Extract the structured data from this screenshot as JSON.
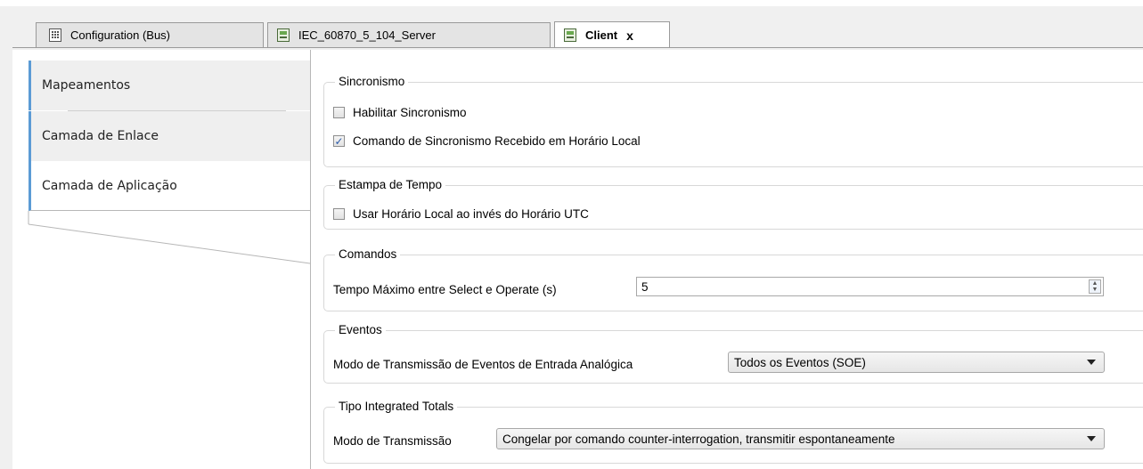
{
  "tabs": [
    {
      "label": "Configuration (Bus)",
      "icon": "bus-config-icon"
    },
    {
      "label": "IEC_60870_5_104_Server",
      "icon": "device-icon"
    },
    {
      "label": "Client",
      "icon": "device-icon",
      "active": true,
      "close": "x"
    }
  ],
  "sidebar": {
    "items": [
      {
        "label": "Mapeamentos"
      },
      {
        "label": "Camada de Enlace"
      },
      {
        "label": "Camada de Aplicação",
        "active": true
      }
    ]
  },
  "groups": {
    "sincronismo": {
      "title": "Sincronismo",
      "habilitar": {
        "label": "Habilitar Sincronismo",
        "checked": false
      },
      "comando_local": {
        "label": "Comando de Sincronismo Recebido em Horário Local",
        "checked": true,
        "mark": "✓"
      }
    },
    "estampa": {
      "title": "Estampa de Tempo",
      "usar_local": {
        "label": "Usar Horário Local ao invés do Horário UTC",
        "checked": false
      }
    },
    "comandos": {
      "title": "Comandos",
      "tempo_label": "Tempo Máximo entre Select e Operate (s)",
      "tempo_value": "5",
      "spin_up": "▲",
      "spin_down": "▼"
    },
    "eventos": {
      "title": "Eventos",
      "modo_label": "Modo de Transmissão de Eventos de Entrada Analógica",
      "modo_value": "Todos os Eventos (SOE)"
    },
    "integrated": {
      "title": "Tipo Integrated Totals",
      "modo_label": "Modo de Transmissão",
      "modo_value": "Congelar por comando counter-interrogation, transmitir espontaneamente"
    }
  },
  "colors": {
    "accent": "#5b9bd5",
    "check": "#2b5aa8"
  }
}
